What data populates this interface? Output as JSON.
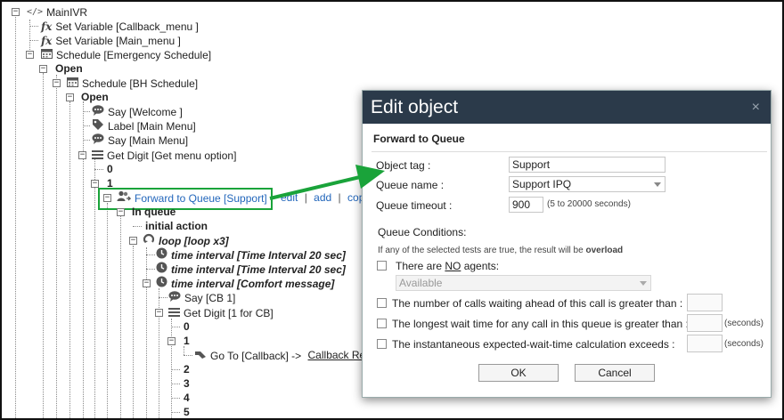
{
  "tree": {
    "mainivr": "MainIVR",
    "set_callback": "Set Variable [Callback_menu ]",
    "set_main": "Set Variable [Main_menu ]",
    "schedule_emergency": "Schedule [Emergency Schedule]",
    "open1": "Open",
    "schedule_bh": "Schedule [BH Schedule]",
    "open2": "Open",
    "say_welcome": "Say [Welcome ]",
    "label_main": "Label [Main Menu]",
    "say_main": "Say [Main Menu]",
    "get_digit_menu": "Get Digit [Get menu option]",
    "digit0": "0",
    "digit1": "1",
    "forward": "Forward to Queue [Support]",
    "edit": "edit",
    "add": "add",
    "copy": "cop",
    "in_queue": "In queue",
    "initial_action": "initial action",
    "loop": "loop [loop x3]",
    "ti1": "time interval [Time Interval 20 sec]",
    "ti2": "time interval [Time Interval 20 sec]",
    "ti3": "time interval [Comfort message]",
    "say_cb1": "Say [CB 1]",
    "get_digit_cb": "Get Digit [1 for CB]",
    "cb0": "0",
    "cb1": "1",
    "goto": "Go To [Callback] ->",
    "goto_link": "Callback Re",
    "cb2": "2",
    "cb3": "3",
    "cb4": "4",
    "cb5": "5"
  },
  "dialog": {
    "title": "Edit object",
    "close": "×",
    "subtitle": "Forward to Queue",
    "object_tag_label": "Object tag :",
    "object_tag_value": "Support",
    "queue_name_label": "Queue name :",
    "queue_name_value": "Support IPQ",
    "queue_timeout_label": "Queue timeout :",
    "queue_timeout_value": "900",
    "queue_timeout_hint": "(5 to 20000 seconds)",
    "conditions_title": "Queue Conditions:",
    "conditions_note_prefix": "If any of the selected tests are true, the result will be",
    "conditions_note_bold": "overload",
    "no_agents_prefix": "There are ",
    "no_agents_no": "NO",
    "no_agents_suffix": " agents:",
    "agents_select": "Available",
    "cond_calls_waiting": "The number of calls waiting ahead of this call is greater than :",
    "cond_longest_wait": "The longest wait time for any call in this queue is greater than :",
    "cond_ewt": "The instantaneous expected-wait-time calculation exceeds :",
    "seconds1": "(seconds)",
    "seconds2": "(seconds)",
    "ok": "OK",
    "cancel": "Cancel"
  },
  "colors": {
    "highlight_box": "#1aa33a",
    "arrow": "#1aa33a",
    "dialog_header": "#2b3a4a"
  }
}
